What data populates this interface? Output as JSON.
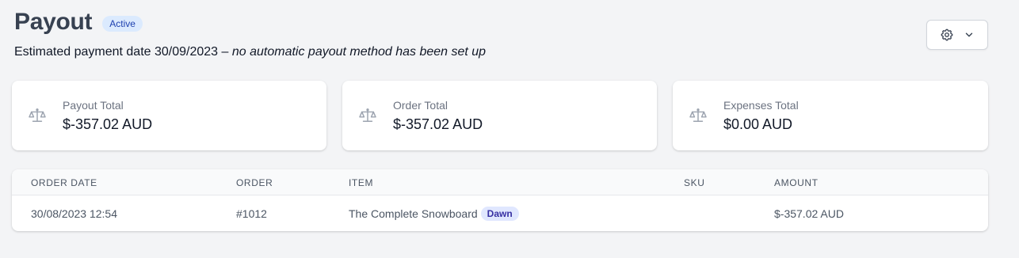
{
  "header": {
    "title": "Payout",
    "status": "Active",
    "subtitle_prefix": "Estimated payment date 30/09/2023 – ",
    "subtitle_note": "no automatic payout method has been set up"
  },
  "toolbar": {
    "settings_icon": "gear-icon",
    "dropdown_icon": "chevron-down-icon"
  },
  "stats": [
    {
      "label": "Payout Total",
      "value": "$-357.02 AUD",
      "icon": "scale-icon"
    },
    {
      "label": "Order Total",
      "value": "$-357.02 AUD",
      "icon": "scale-icon"
    },
    {
      "label": "Expenses Total",
      "value": "$0.00 AUD",
      "icon": "scale-icon"
    }
  ],
  "table": {
    "columns": [
      "ORDER DATE",
      "ORDER",
      "ITEM",
      "SKU",
      "AMOUNT"
    ],
    "rows": [
      {
        "order_date": "30/08/2023 12:54",
        "order": "#1012",
        "item": "The Complete Snowboard",
        "variant": "Dawn",
        "sku": "",
        "amount": "$-357.02 AUD"
      }
    ]
  },
  "colors": {
    "background": "#f3f4f6",
    "status_badge_bg": "#dbeafe",
    "status_badge_text": "#1e40af",
    "variant_badge_bg": "#e0e7ff",
    "variant_badge_text": "#3730a3"
  }
}
